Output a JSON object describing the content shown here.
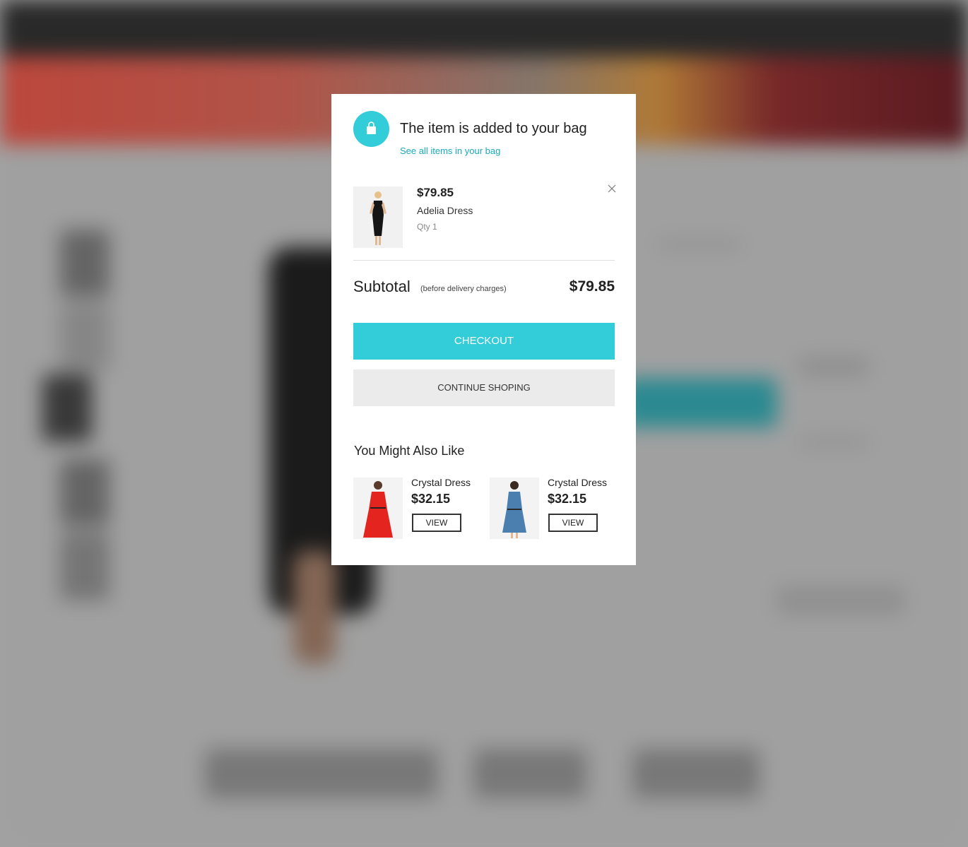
{
  "modal": {
    "title": "The item is added to your bag",
    "see_all_link": "See all items in your bag",
    "icon": "shopping-bag-icon",
    "close_icon": "close-icon"
  },
  "cart_item": {
    "price": "$79.85",
    "name": "Adelia Dress",
    "qty": "Qty 1"
  },
  "subtotal": {
    "label": "Subtotal",
    "note": "(before delivery charges)",
    "value": "$79.85"
  },
  "buttons": {
    "checkout": "CHECKOUT",
    "continue": "CONTINUE SHOPING"
  },
  "recommendations": {
    "heading": "You Might Also Like",
    "items": [
      {
        "name": "Crystal Dress",
        "price": "$32.15",
        "view": "VIEW"
      },
      {
        "name": "Crystal Dress",
        "price": "$32.15",
        "view": "VIEW"
      }
    ]
  },
  "colors": {
    "accent": "#33ccd9",
    "link": "#18aabb",
    "secondary_button": "#ebebeb"
  }
}
